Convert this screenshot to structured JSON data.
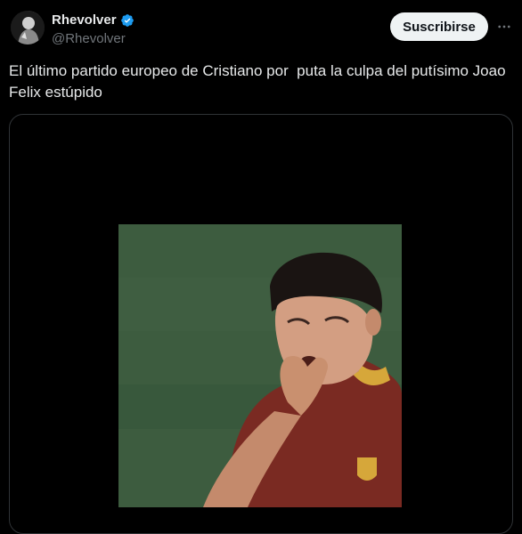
{
  "author": {
    "display_name": "Rhevolver",
    "handle": "@Rhevolver",
    "verified": true,
    "avatar_icon": "avatar-photo"
  },
  "actions": {
    "subscribe_label": "Suscribirse",
    "more_icon": "more-icon"
  },
  "tweet": {
    "text": "El último partido europeo de Cristiano por  puta la culpa del putísimo Joao Felix estúpido"
  },
  "media": {
    "type": "video",
    "content": "player-crying-photo"
  },
  "colors": {
    "background": "#000000",
    "text": "#e7e9ea",
    "muted": "#71767b",
    "verified": "#1d9bf0",
    "button_bg": "#eff3f4",
    "border": "#2f3336"
  }
}
